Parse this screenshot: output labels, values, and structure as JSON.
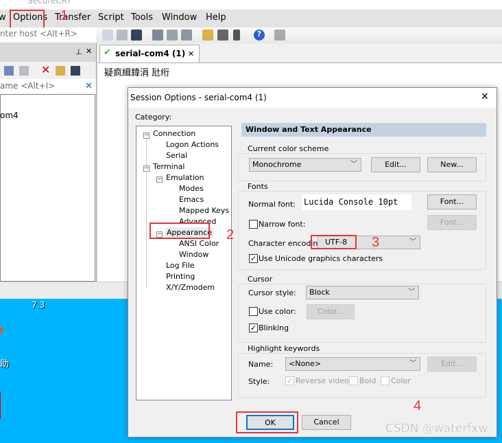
{
  "app": {
    "title": "SecureCRT"
  },
  "menu": [
    "w",
    "Options",
    "Transfer",
    "Script",
    "Tools",
    "Window",
    "Help"
  ],
  "toolbar": {
    "host_placeholder": "nter host <Alt+R>"
  },
  "session_panel": {
    "filter_placeholder": "ame <Alt+I>",
    "item": "om4"
  },
  "tab": {
    "label": "serial-com4 (1)",
    "close": "✕"
  },
  "terminal": {
    "text": "疑疯緝鍏涓  瓧绗"
  },
  "desktop": {
    "label1": "7.3",
    "label2": "助"
  },
  "annotations": [
    "1",
    "2",
    "3",
    "4"
  ],
  "watermark": "CSDN @waterfxw",
  "dialog": {
    "title": "Session Options - serial-com4 (1)",
    "close": "✕",
    "category_label": "Category:",
    "tree": [
      "Connection",
      "Logon Actions",
      "Serial",
      "Terminal",
      "Emulation",
      "Modes",
      "Emacs",
      "Mapped Keys",
      "Advanced",
      "Appearance",
      "ANSI Color",
      "Window",
      "Log File",
      "Printing",
      "X/Y/Zmodem"
    ],
    "selected": "Appearance",
    "header": "Window and Text Appearance",
    "color_scheme": {
      "label": "Current color scheme",
      "value": "Monochrome",
      "edit": "Edit...",
      "new": "New..."
    },
    "fonts": {
      "label": "Fonts",
      "normal_label": "Normal font:",
      "normal_value": "Lucida Console 10pt",
      "font_btn": "Font...",
      "narrow_label": "Narrow font:",
      "narrow_checked": false,
      "narrow_btn": "Font...",
      "encoding_label": "Character encoding:",
      "encoding_value": "UTF-8",
      "unicode_label": "Use Unicode graphics characters",
      "unicode_checked": true
    },
    "cursor": {
      "label": "Cursor",
      "style_label": "Cursor style:",
      "style_value": "Block",
      "use_color_label": "Use color:",
      "use_color_checked": false,
      "color_btn": "Color...",
      "blinking_label": "Blinking",
      "blinking_checked": true
    },
    "highlight": {
      "label": "Highlight keywords",
      "name_label": "Name:",
      "name_value": "<None>",
      "edit": "Edit...",
      "style_label": "Style:",
      "reverse": "Reverse video",
      "bold": "Bold",
      "color": "Color"
    },
    "ok": "OK",
    "cancel": "Cancel"
  },
  "colors": {
    "accent": "#0078d7",
    "annotation": "#e8333a",
    "desktop": "#00b4ff",
    "header": "#c4d2e0"
  }
}
